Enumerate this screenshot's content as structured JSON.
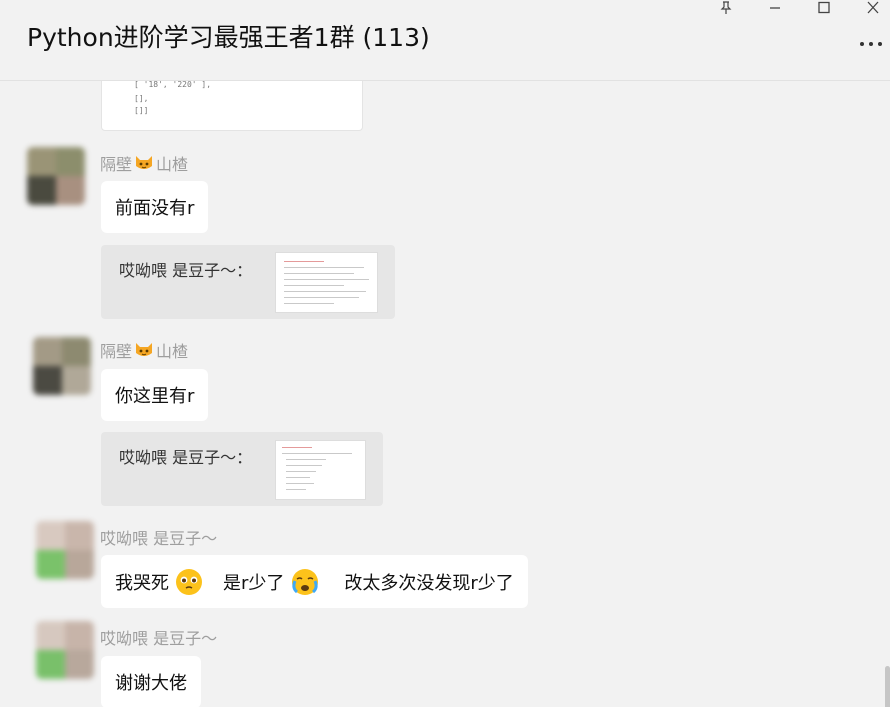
{
  "window": {
    "title": "Python进阶学习最强王者1群 (113)",
    "controls": [
      "pin-icon",
      "minimize-icon",
      "maximize-icon",
      "close-icon"
    ],
    "more_icon": "more-icon"
  },
  "code_snippet": {
    "lines": [
      "[ '18', '220' ],",
      "[],",
      "[]]"
    ]
  },
  "messages": [
    {
      "sender": {
        "name_a": "隔壁",
        "emoji": "cat-face-emoji",
        "name_b": "山楂"
      },
      "text": "前面没有r",
      "reply": {
        "quote_text": "哎呦喂  是豆子～：",
        "has_image": true
      }
    },
    {
      "sender": {
        "name_a": "隔壁",
        "emoji": "cat-face-emoji",
        "name_b": "山楂"
      },
      "text": "你这里有r",
      "reply": {
        "quote_text": "哎呦喂  是豆子～：",
        "has_image": true
      }
    },
    {
      "sender": {
        "name": "哎呦喂  是豆子～"
      },
      "segments": [
        "我哭死",
        "是r少了",
        "改太多次没发现r少了"
      ],
      "emojis": [
        "teary-face-emoji",
        "crying-face-emoji"
      ]
    },
    {
      "sender": {
        "name": "哎呦喂  是豆子～"
      },
      "text": "谢谢大佬"
    }
  ],
  "colors": {
    "background": "#f2f2f2",
    "bubble": "#ffffff",
    "quote_bg": "#e6e6e6",
    "sender_text": "#9e9e9e"
  }
}
